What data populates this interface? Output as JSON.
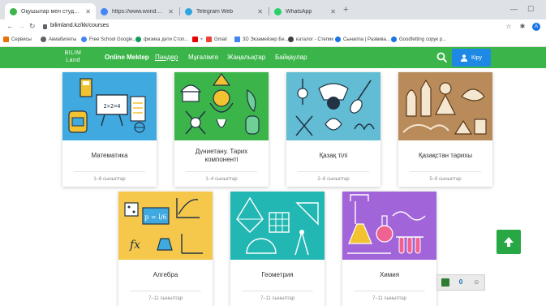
{
  "browser": {
    "tabs": [
      {
        "label": "Оқушылар мен студенттерге ар",
        "active": true,
        "color": "#3bb54a"
      },
      {
        "label": "https://www.wonderbrand.com/c",
        "active": false,
        "color": "#4285f4"
      },
      {
        "label": "Telegram Web",
        "active": false,
        "color": "#2ca5e0"
      },
      {
        "label": "WhatsApp",
        "active": false,
        "color": "#25d366"
      }
    ],
    "url": "bilimland.kz/kk/courses",
    "profile_initial": "A",
    "bookmarks": [
      {
        "label": "Сервисы",
        "color": "#e8710a"
      },
      {
        "label": "Авиабилеты",
        "color": "#5f6368"
      },
      {
        "label": "Free School Google...",
        "color": "#4285f4"
      },
      {
        "label": "физика дети Стоп...",
        "color": "#0f9d58"
      },
      {
        "label": "Gmail",
        "color": "#ea4335"
      },
      {
        "label": "3D Экзамейзер Бе...",
        "color": "#4285f4"
      },
      {
        "label": "каталог - Степик",
        "color": "#3c4043"
      },
      {
        "label": "Сынаппа | Развива...",
        "color": "#1a73e8"
      },
      {
        "label": "Goodfetting сорук р...",
        "color": "#1a73e8"
      }
    ]
  },
  "site": {
    "logo_line1": "BILIM",
    "logo_line2": "Land",
    "nav": [
      "Online Mektep",
      "Пәндер",
      "Мұғалімге",
      "Жаңалықтар",
      "Байқаулар"
    ],
    "login_label": "Кіру",
    "brand_color": "#3bb54a"
  },
  "courses": [
    {
      "title": "Математика",
      "grades": "1–6 сыныптар",
      "color": "#3fa9e0"
    },
    {
      "title": "Дүниетану. Тарих компоненті",
      "grades": "1–4 сыныптар",
      "color": "#3bb54a"
    },
    {
      "title": "Қазақ тілі",
      "grades": "2–6 сыныптар",
      "color": "#62bcd4"
    },
    {
      "title": "Қазақстан тарихы",
      "grades": "5–9 сыныптар",
      "color": "#b98b5a"
    },
    {
      "title": "Алгебра",
      "grades": "7–11 сыныптар",
      "color": "#f5c84c"
    },
    {
      "title": "Геометрия",
      "grades": "7–11 сыныптар",
      "color": "#23b7b3"
    },
    {
      "title": "Химия",
      "grades": "7–11 сыныптар",
      "color": "#a265d9"
    }
  ]
}
